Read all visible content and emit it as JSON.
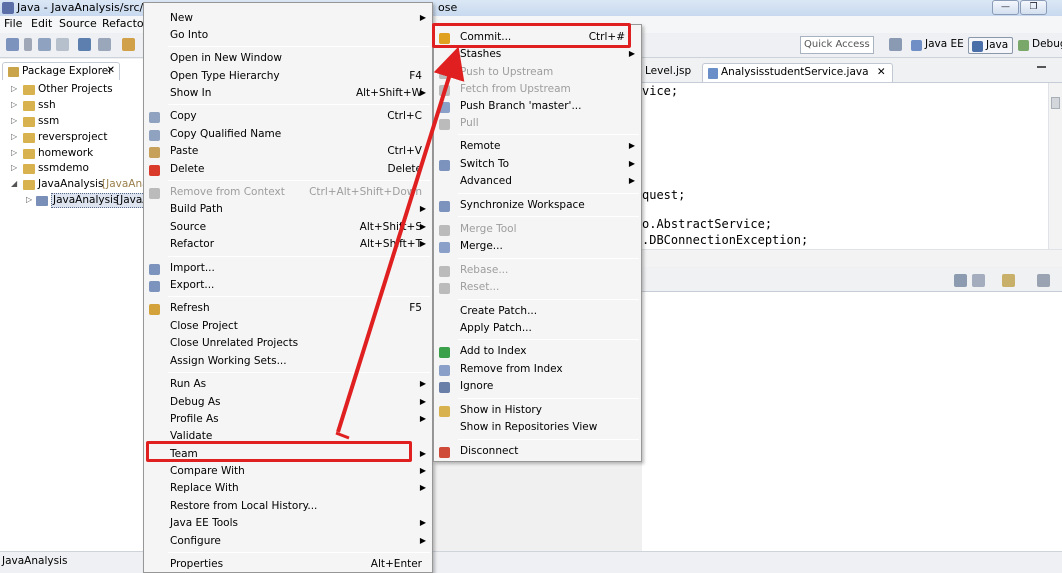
{
  "window": {
    "title": "Java - JavaAnalysis/src/cned",
    "title_tail": "ose",
    "minimize": "—",
    "maximize": "❐",
    "close": "✕"
  },
  "menubar": [
    "File",
    "Edit",
    "Source",
    "Refactor"
  ],
  "toolbar": {
    "quick_access_placeholder": "Quick Access",
    "perspectives": [
      "Java EE",
      "Java",
      "Debug"
    ]
  },
  "package_explorer": {
    "tab_label": "Package Explorer",
    "items": [
      {
        "label": "Other Projects",
        "suffix": ""
      },
      {
        "label": "ssh",
        "suffix": ""
      },
      {
        "label": "ssm",
        "suffix": ""
      },
      {
        "label": "reversproject",
        "suffix": ""
      },
      {
        "label": "homework",
        "suffix": ""
      },
      {
        "label": "ssmdemo",
        "suffix": ""
      },
      {
        "label": "JavaAnalysis",
        "suffix": "[JavaAnal"
      },
      {
        "label": "JavaAnalysis",
        "suffix": "[JavaAn"
      }
    ]
  },
  "editor": {
    "tabs": [
      "Level.jsp",
      "AnalysisstudentService.java"
    ],
    "code_lines": [
      "vice;",
      "quest;",
      "o.AbstractService;",
      ".DBConnectionException;"
    ]
  },
  "status_bar": {
    "text": "JavaAnalysis"
  },
  "context_menu": {
    "items": [
      {
        "label": "New",
        "sub": true
      },
      {
        "label": "Go Into"
      },
      {
        "label": "Open in New Window"
      },
      {
        "label": "Open Type Hierarchy",
        "shortcut": "F4"
      },
      {
        "label": "Show In",
        "shortcut": "Alt+Shift+W",
        "sub": true
      },
      {
        "label": "Copy",
        "shortcut": "Ctrl+C"
      },
      {
        "label": "Copy Qualified Name"
      },
      {
        "label": "Paste",
        "shortcut": "Ctrl+V"
      },
      {
        "label": "Delete",
        "shortcut": "Delete"
      },
      {
        "label": "Remove from Context",
        "shortcut": "Ctrl+Alt+Shift+Down",
        "disabled": true
      },
      {
        "label": "Build Path",
        "sub": true
      },
      {
        "label": "Source",
        "shortcut": "Alt+Shift+S",
        "sub": true
      },
      {
        "label": "Refactor",
        "shortcut": "Alt+Shift+T",
        "sub": true
      },
      {
        "label": "Import..."
      },
      {
        "label": "Export..."
      },
      {
        "label": "Refresh",
        "shortcut": "F5"
      },
      {
        "label": "Close Project"
      },
      {
        "label": "Close Unrelated Projects"
      },
      {
        "label": "Assign Working Sets..."
      },
      {
        "label": "Run As",
        "sub": true
      },
      {
        "label": "Debug As",
        "sub": true
      },
      {
        "label": "Profile As",
        "sub": true
      },
      {
        "label": "Validate"
      },
      {
        "label": "Team",
        "sub": true,
        "highlighted": true
      },
      {
        "label": "Compare With",
        "sub": true
      },
      {
        "label": "Replace With",
        "sub": true
      },
      {
        "label": "Restore from Local History..."
      },
      {
        "label": "Java EE Tools",
        "sub": true
      },
      {
        "label": "Configure",
        "sub": true
      },
      {
        "label": "Properties",
        "shortcut": "Alt+Enter"
      }
    ]
  },
  "team_menu": {
    "items": [
      {
        "label": "Commit...",
        "shortcut": "Ctrl+#",
        "highlighted": true
      },
      {
        "label": "Stashes",
        "sub": true
      },
      {
        "label": "Push to Upstream",
        "disabled": true
      },
      {
        "label": "Fetch from Upstream",
        "disabled": true
      },
      {
        "label": "Push Branch 'master'..."
      },
      {
        "label": "Pull",
        "disabled": true
      },
      {
        "label": "Remote",
        "sub": true
      },
      {
        "label": "Switch To",
        "sub": true
      },
      {
        "label": "Advanced",
        "sub": true
      },
      {
        "label": "Synchronize Workspace"
      },
      {
        "label": "Merge Tool",
        "disabled": true
      },
      {
        "label": "Merge..."
      },
      {
        "label": "Rebase...",
        "disabled": true
      },
      {
        "label": "Reset...",
        "disabled": true
      },
      {
        "label": "Create Patch..."
      },
      {
        "label": "Apply Patch..."
      },
      {
        "label": "Add to Index"
      },
      {
        "label": "Remove from Index"
      },
      {
        "label": "Ignore"
      },
      {
        "label": "Show in History"
      },
      {
        "label": "Show in Repositories View"
      },
      {
        "label": "Disconnect"
      }
    ]
  },
  "colors": {
    "annotation": "#e02020",
    "disabled_text": "#9d9d9d"
  },
  "symbols": {
    "submenu_arrow": "▶",
    "tree_expand": "▷",
    "tree_expanded": "◢",
    "close_x": "✕"
  }
}
